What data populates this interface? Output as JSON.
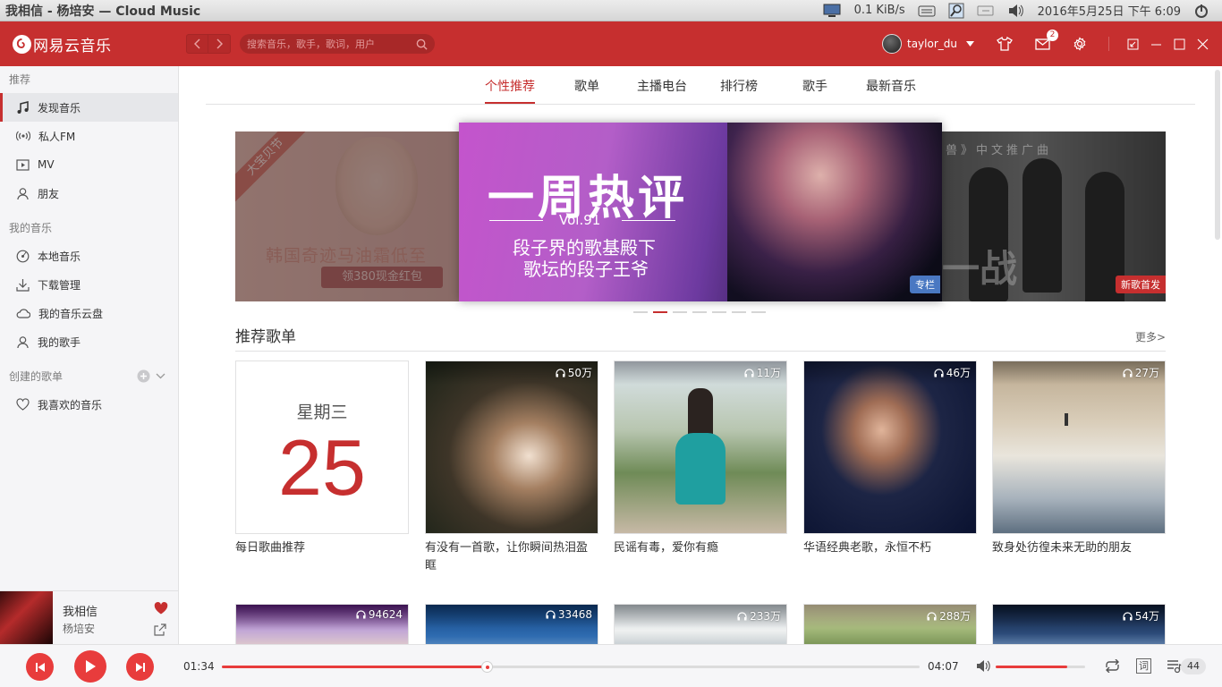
{
  "system_panel": {
    "window_title": "我相信 - 杨培安 — Cloud Music",
    "net_speed": "0.1 KiB/s",
    "datetime": "2016年5月25日 下午 6:09"
  },
  "header": {
    "brand": "网易云音乐",
    "search_placeholder": "搜索音乐，歌手，歌词，用户",
    "username": "taylor_du",
    "message_count": "2",
    "accent_color": "#c62f2f"
  },
  "sidebar": {
    "sections": {
      "recommend": "推荐",
      "my_music": "我的音乐",
      "created": "创建的歌单"
    },
    "recommend_items": [
      {
        "label": "发现音乐",
        "icon": "music-note-icon"
      },
      {
        "label": "私人FM",
        "icon": "radio-icon"
      },
      {
        "label": "MV",
        "icon": "video-icon"
      },
      {
        "label": "朋友",
        "icon": "friends-icon"
      }
    ],
    "my_music_items": [
      {
        "label": "本地音乐",
        "icon": "disc-icon"
      },
      {
        "label": "下载管理",
        "icon": "download-icon"
      },
      {
        "label": "我的音乐云盘",
        "icon": "cloud-icon"
      },
      {
        "label": "我的歌手",
        "icon": "singer-icon"
      }
    ],
    "created_items": [
      {
        "label": "我喜欢的音乐",
        "icon": "heart-icon"
      }
    ]
  },
  "now_playing": {
    "song": "我相信",
    "artist": "杨培安"
  },
  "tabs": [
    "个性推荐",
    "歌单",
    "主播电台",
    "排行榜",
    "歌手",
    "最新音乐"
  ],
  "active_tab": "个性推荐",
  "banner": {
    "left": {
      "ribbon": "大宝贝节",
      "headline": "韩国奇迹马油霜低至",
      "button": "领380现金红包"
    },
    "center": {
      "title": "一周热评",
      "vol": "Vol.91",
      "line1": "段子界的歌基殿下",
      "line2": "歌坛的段子王爷",
      "tag": "专栏"
    },
    "right": {
      "top_text": "兽》中文推广曲",
      "big_text": "一战",
      "tag": "新歌首发"
    },
    "dot_count": 7,
    "active_dot": 1
  },
  "recommended": {
    "title": "推荐歌单",
    "more": "更多>",
    "daily": {
      "weekday": "星期三",
      "day": "25",
      "title": "每日歌曲推荐"
    },
    "playlists": [
      {
        "plays": "50万",
        "title": "有没有一首歌，让你瞬间热泪盈眶"
      },
      {
        "plays": "11万",
        "title": "民谣有毒，爱你有瘾"
      },
      {
        "plays": "46万",
        "title": "华语经典老歌，永恒不朽"
      },
      {
        "plays": "27万",
        "title": "致身处彷徨未来无助的朋友"
      }
    ],
    "second_row": [
      {
        "plays": "94624"
      },
      {
        "plays": "33468"
      },
      {
        "plays": "233万"
      },
      {
        "plays": "288万"
      },
      {
        "plays": "54万"
      }
    ]
  },
  "player": {
    "current_time": "01:34",
    "total_time": "04:07",
    "progress": 0.38,
    "volume": 0.8,
    "playlist_count": "44",
    "lyrics_label": "词"
  }
}
